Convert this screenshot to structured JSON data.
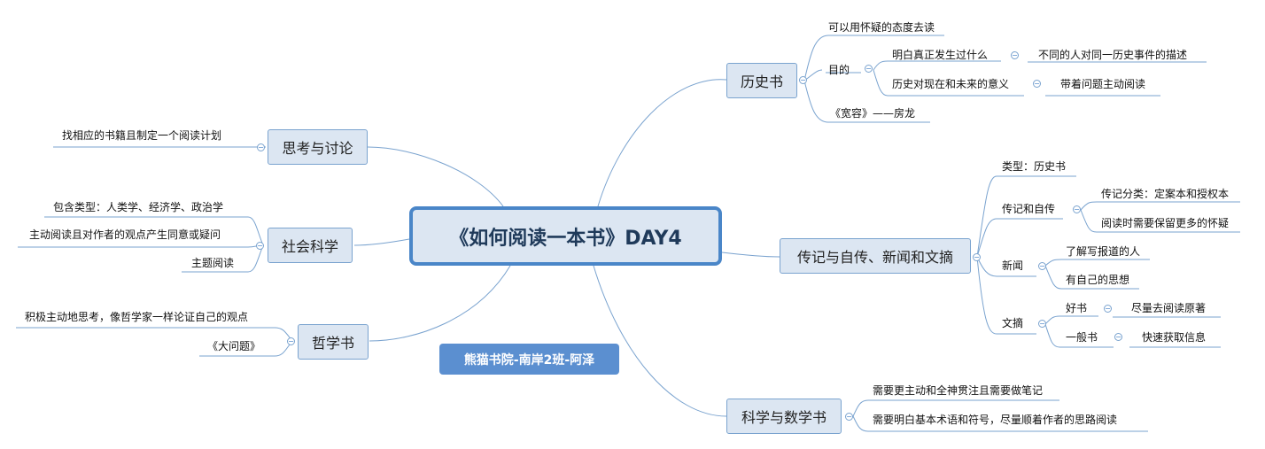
{
  "central": "《如何阅读一本书》DAY4",
  "author": "熊猫书院-南岸2班-阿泽",
  "history": {
    "label": "历史书",
    "attitude": "可以用怀疑的态度去读",
    "purpose": "目的",
    "purpose_1": "明白真正发生过什么",
    "purpose_1_child": "不同的人对同一历史事件的描述",
    "purpose_2": "历史对现在和未来的意义",
    "purpose_2_child": "带着问题主动阅读",
    "example": "《宽容》——房龙"
  },
  "biography": {
    "label": "传记与自传、新闻和文摘",
    "type": "类型：历史书",
    "bio": "传记和自传",
    "bio_1": "传记分类：定案本和授权本",
    "bio_2": "阅读时需要保留更多的怀疑",
    "news": "新闻",
    "news_1": "了解写报道的人",
    "news_2": "有自己的思想",
    "digest": "文摘",
    "good": "好书",
    "good_child": "尽量去阅读原著",
    "normal": "一般书",
    "normal_child": "快速获取信息"
  },
  "science": {
    "label": "科学与数学书",
    "s1": "需要更主动和全神贯注且需要做笔记",
    "s2": "需要明白基本术语和符号，尽量顺着作者的思路阅读"
  },
  "thinking": {
    "label": "思考与讨论",
    "t1": "找相应的书籍且制定一个阅读计划"
  },
  "social": {
    "label": "社会科学",
    "s1": "包含类型：人类学、经济学、政治学",
    "s2": "主动阅读且对作者的观点产生同意或疑问",
    "s3": "主题阅读"
  },
  "philosophy": {
    "label": "哲学书",
    "p1": "积极主动地思考，像哲学家一样论证自己的观点",
    "p2": "《大问题》"
  },
  "colors": {
    "line": "#7aa3cf",
    "fill": "#dce6f2",
    "central_border": "#4a86c8",
    "author_fill": "#5b8fd0"
  },
  "toggle_symbol": "−"
}
